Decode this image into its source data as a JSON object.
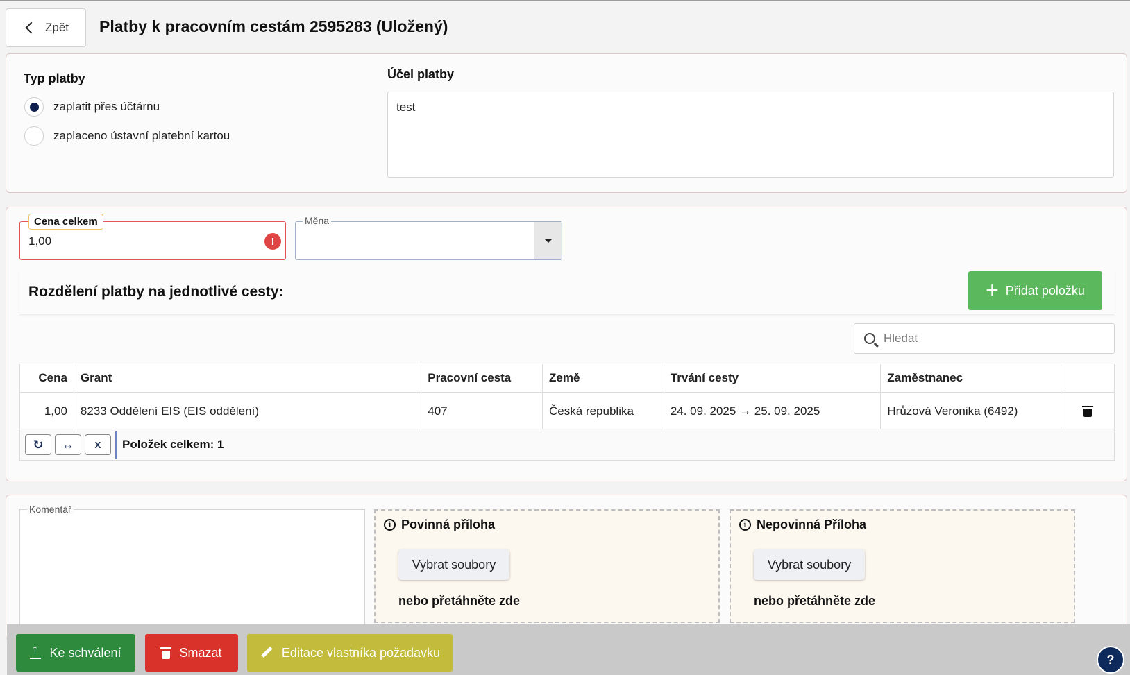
{
  "header": {
    "back_label": "Zpět",
    "title": "Platby k pracovním cestám 2595283 (Uložený)"
  },
  "payment_type": {
    "label": "Typ platby",
    "options": [
      {
        "label": "zaplatit přes účtárnu",
        "selected": true
      },
      {
        "label": "zaplaceno ústavní platební kartou",
        "selected": false
      }
    ]
  },
  "purpose": {
    "label": "Účel platby",
    "value": "test"
  },
  "price": {
    "label": "Cena celkem",
    "value": "1,00",
    "error_icon": "!"
  },
  "currency": {
    "label": "Měna",
    "value": ""
  },
  "split": {
    "title": "Rozdělení platby na jednotlivé cesty:",
    "add_label": "Přidat položku",
    "search_placeholder": "Hledat",
    "columns": [
      "Cena",
      "Grant",
      "Pracovní cesta",
      "Země",
      "Trvání cesty",
      "Zaměstnanec"
    ],
    "rows": [
      {
        "cena": "1,00",
        "grant": "8233 Oddělení EIS (EIS oddělení)",
        "cesta": "407",
        "zeme": "Česká republika",
        "trvani": "24. 09. 2025 → 25. 09. 2025",
        "zamestnanec": "Hrůzová Veronika (6492)"
      }
    ],
    "footer_count": "Položek celkem: 1"
  },
  "comment": {
    "label": "Komentář"
  },
  "attachments": {
    "required": {
      "title": "Povinná příloha",
      "button": "Vybrat soubory",
      "hint": "nebo přetáhněte zde"
    },
    "optional": {
      "title": "Nepovinná Příloha",
      "button": "Vybrat soubory",
      "hint": "nebo přetáhněte zde"
    }
  },
  "actions": {
    "approve": "Ke schválení",
    "delete": "Smazat",
    "edit_owner": "Editace vlastníka požadavku"
  },
  "icons": [
    "chevron-left-icon",
    "error-icon",
    "chevron-down-icon",
    "plus-icon",
    "search-icon",
    "trash-icon",
    "refresh-icon",
    "fit-columns-icon",
    "excel-icon",
    "info-icon",
    "upload-icon",
    "pencil-icon",
    "help-icon"
  ],
  "colors": {
    "accent_green": "#5cb85c",
    "approve": "#2e8b3d",
    "delete": "#d9322b",
    "edit": "#c2bb3c",
    "radio": "#0e1f4d"
  }
}
